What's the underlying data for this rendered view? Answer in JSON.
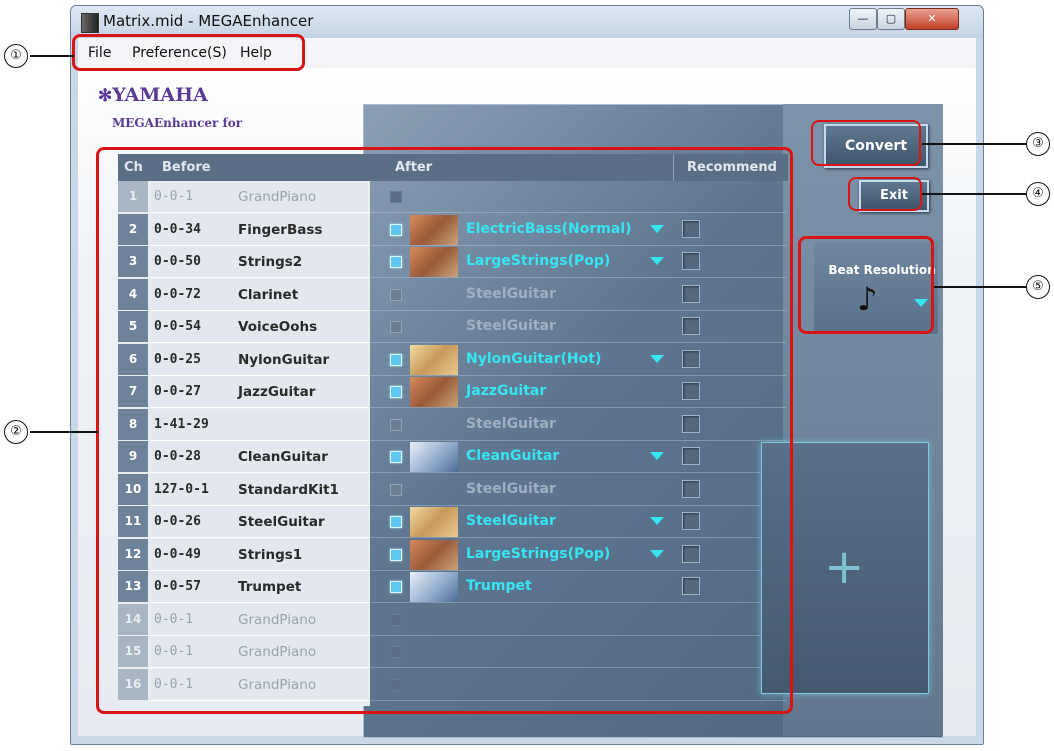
{
  "window": {
    "title": "Matrix.mid - MEGAEnhancer",
    "controls": {
      "minimize": "—",
      "maximize": "▢",
      "close": "✕"
    }
  },
  "menu": {
    "file": "File",
    "preference": "Preference(S)",
    "help": "Help"
  },
  "branding": {
    "logo": "YAMAHA",
    "product": "MEGAEnhancer for"
  },
  "table": {
    "headers": {
      "ch": "Ch",
      "before": "Before",
      "after": "After",
      "recommend": "Recommend"
    },
    "rows": [
      {
        "ch": "1",
        "num": "0-0-1",
        "name": "GrandPiano",
        "active": false
      },
      {
        "ch": "2",
        "num": "0-0-34",
        "name": "FingerBass",
        "active": true,
        "checked": true,
        "after": "ElectricBass(Normal)",
        "thumb": "bass",
        "dropdown": true
      },
      {
        "ch": "3",
        "num": "0-0-50",
        "name": "Strings2",
        "active": true,
        "checked": true,
        "after": "LargeStrings(Pop)",
        "thumb": "strings",
        "dropdown": true
      },
      {
        "ch": "4",
        "num": "0-0-72",
        "name": "Clarinet",
        "active": true,
        "checked": false,
        "after": "SteelGuitar",
        "thumb": "",
        "dropdown": false
      },
      {
        "ch": "5",
        "num": "0-0-54",
        "name": "VoiceOohs",
        "active": true,
        "checked": false,
        "after": "SteelGuitar",
        "thumb": "",
        "dropdown": false
      },
      {
        "ch": "6",
        "num": "0-0-25",
        "name": "NylonGuitar",
        "active": true,
        "checked": true,
        "after": "NylonGuitar(Hot)",
        "thumb": "guitar",
        "dropdown": true
      },
      {
        "ch": "7",
        "num": "0-0-27",
        "name": "JazzGuitar",
        "active": true,
        "checked": true,
        "after": "JazzGuitar",
        "thumb": "strings",
        "dropdown": false
      },
      {
        "ch": "8",
        "num": "1-41-29",
        "name": "",
        "active": true,
        "checked": false,
        "after": "SteelGuitar",
        "thumb": "",
        "dropdown": false
      },
      {
        "ch": "9",
        "num": "0-0-28",
        "name": "CleanGuitar",
        "active": true,
        "checked": true,
        "after": "CleanGuitar",
        "thumb": "egtr",
        "dropdown": true
      },
      {
        "ch": "10",
        "num": "127-0-1",
        "name": "StandardKit1",
        "active": true,
        "checked": false,
        "after": "SteelGuitar",
        "thumb": "",
        "dropdown": false
      },
      {
        "ch": "11",
        "num": "0-0-26",
        "name": "SteelGuitar",
        "active": true,
        "checked": true,
        "after": "SteelGuitar",
        "thumb": "guitar",
        "dropdown": true
      },
      {
        "ch": "12",
        "num": "0-0-49",
        "name": "Strings1",
        "active": true,
        "checked": true,
        "after": "LargeStrings(Pop)",
        "thumb": "strings",
        "dropdown": true
      },
      {
        "ch": "13",
        "num": "0-0-57",
        "name": "Trumpet",
        "active": true,
        "checked": true,
        "after": "Trumpet",
        "thumb": "trumpet",
        "dropdown": false
      },
      {
        "ch": "14",
        "num": "0-0-1",
        "name": "GrandPiano",
        "active": false
      },
      {
        "ch": "15",
        "num": "0-0-1",
        "name": "GrandPiano",
        "active": false
      },
      {
        "ch": "16",
        "num": "0-0-1",
        "name": "GrandPiano",
        "active": false
      }
    ]
  },
  "buttons": {
    "convert": "Convert",
    "exit": "Exit"
  },
  "beat": {
    "label": "Beat Resolution",
    "note": "♪"
  },
  "drop": {
    "plus": "+"
  },
  "callouts": [
    "①",
    "②",
    "③",
    "④",
    "⑤"
  ],
  "colors": {
    "highlight": "#d81414",
    "accent": "#35e6f2"
  }
}
